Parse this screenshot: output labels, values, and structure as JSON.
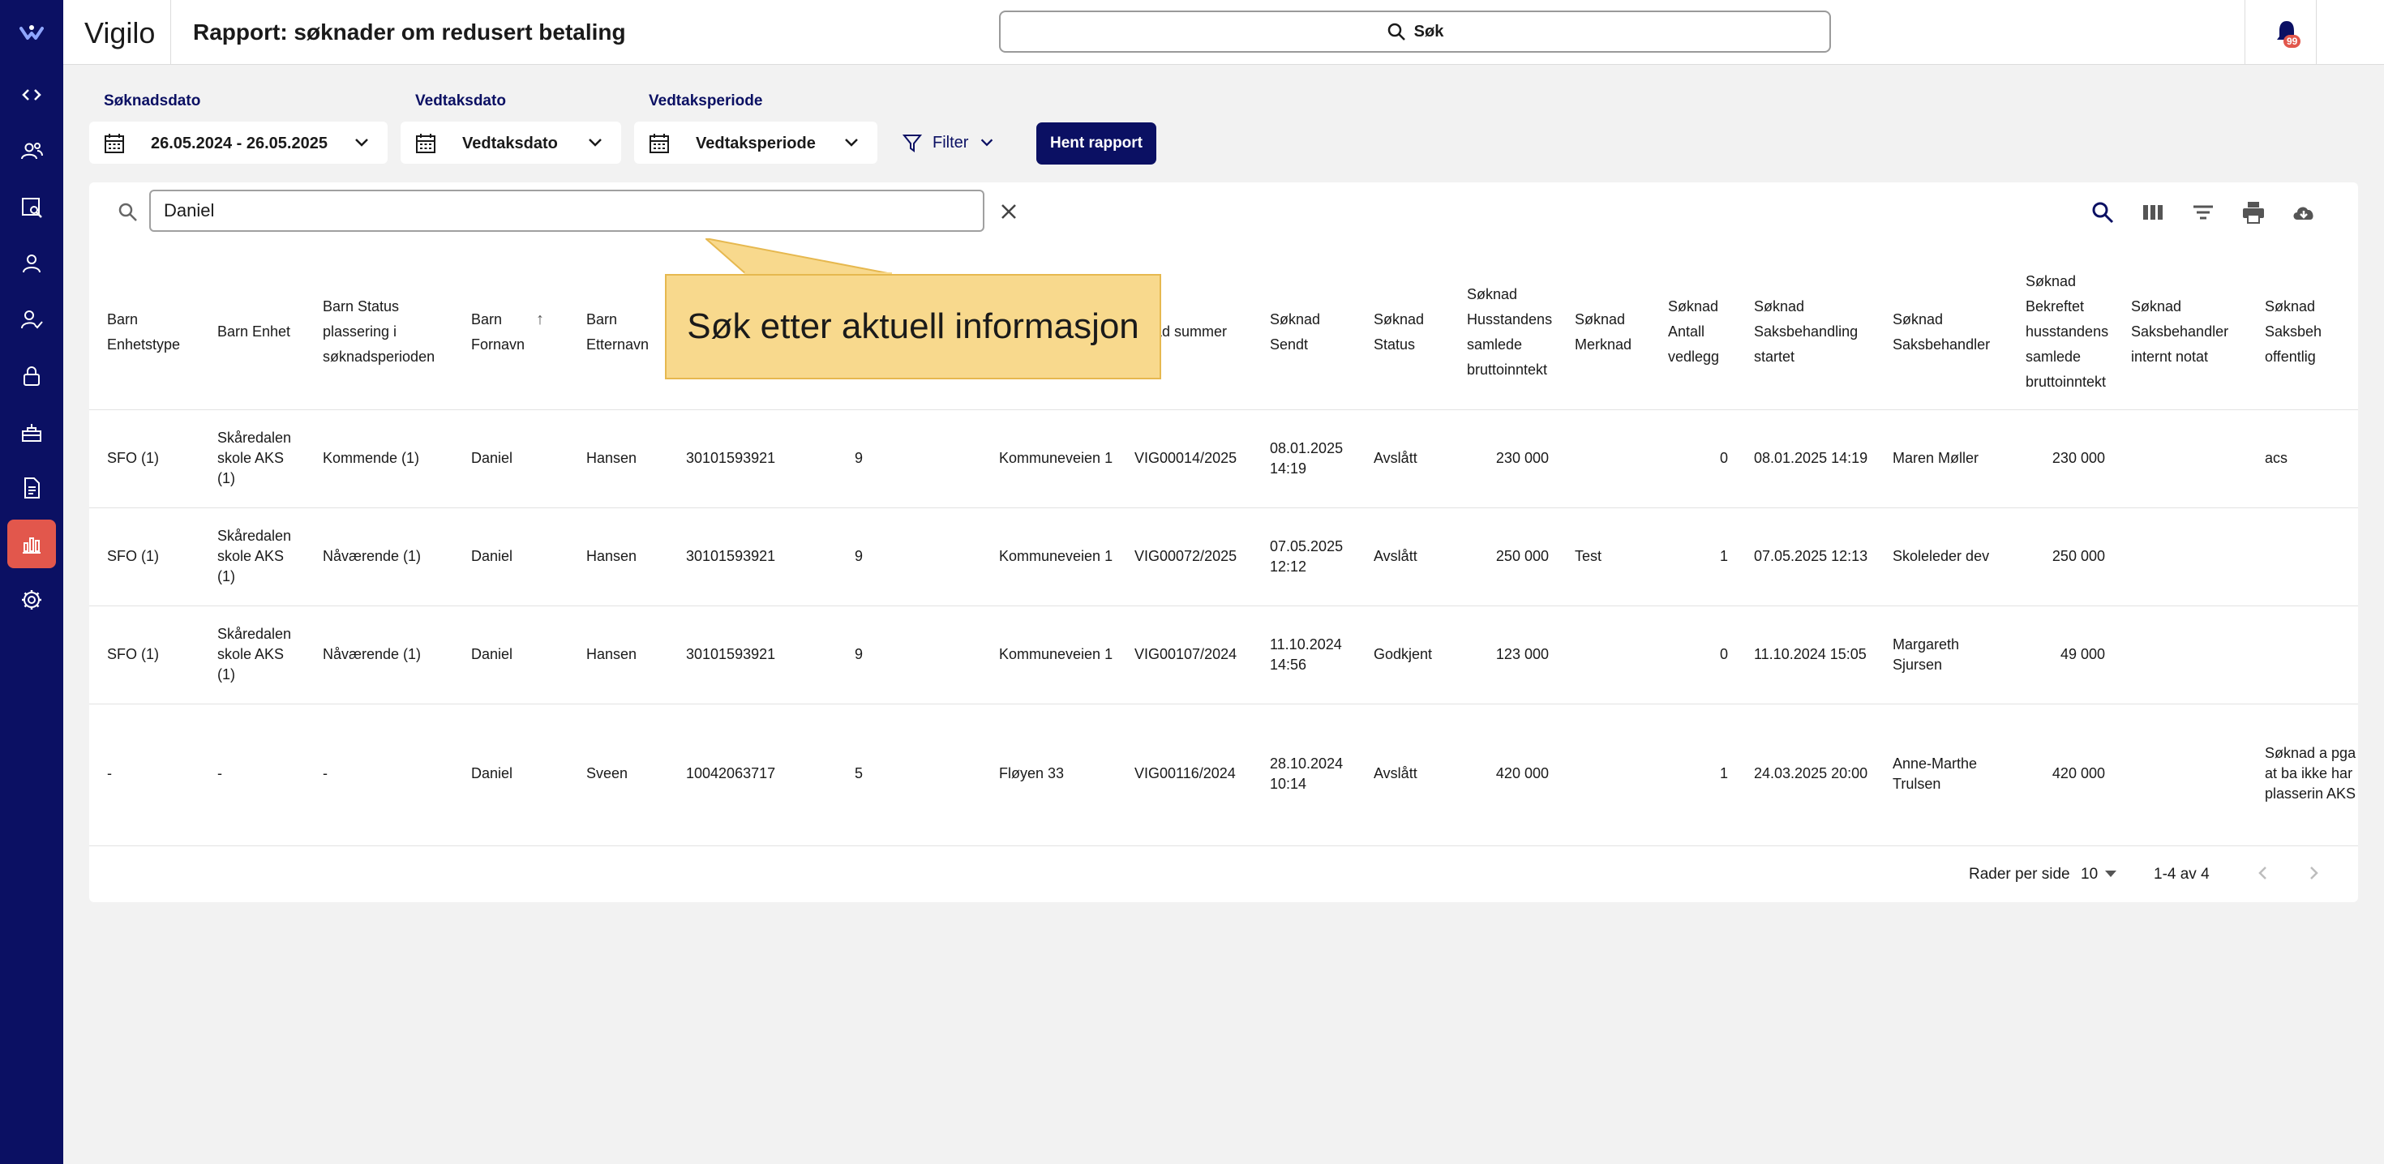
{
  "app": {
    "brand": "Vigilo",
    "page_title": "Rapport: søknader om redusert betaling",
    "global_search_label": "Søk",
    "notification_count": "99"
  },
  "sidebar": {
    "icons": [
      "vigilo-logo-icon",
      "code-icon",
      "group-icon",
      "image-search-icon",
      "person-icon",
      "person-check-icon",
      "lock-icon",
      "lunchbox-icon",
      "document-icon",
      "report-chart-icon",
      "gear-icon"
    ],
    "active": "report-chart-icon",
    "active_color": "#e2574c",
    "bg_color": "#0b1063"
  },
  "filters": {
    "soknadsdato_label": "Søknadsdato",
    "soknadsdato_value": "26.05.2024 - 26.05.2025",
    "vedtaksdato_label": "Vedtaksdato",
    "vedtaksdato_value": "Vedtaksdato",
    "vedtaksperiode_label": "Vedtaksperiode",
    "vedtaksperiode_value": "Vedtaksperiode",
    "filter_label": "Filter",
    "hent_label": "Hent rapport"
  },
  "table_search": {
    "value": "Daniel"
  },
  "tooltip": {
    "text": "Søk etter aktuell informasjon",
    "color": "#f8d98d"
  },
  "table": {
    "headers": {
      "h0": "Barn Enhetstype",
      "h1": "Barn Enhet",
      "h2": "Barn Status plassering i søknadsperioden",
      "h3": "Barn Fornavn",
      "h4": "Barn Etternavn",
      "h5": "",
      "h6": "",
      "h7": "",
      "h8": "nad summer",
      "h9": "Søknad Sendt",
      "h10": "Søknad Status",
      "h11": "Søknad Husstandens samlede bruttoinntekt",
      "h12": "Søknad Merknad",
      "h13": "Søknad Antall vedlegg",
      "h14": "Søknad Saksbehandling startet",
      "h15": "Søknad Saksbehandler",
      "h16": "Søknad Bekreftet husstandens samlede bruttoinntekt",
      "h17": "Søknad Saksbehandler internt notat",
      "h18": "Søknad Saksbeh offentlig"
    },
    "rows": [
      {
        "c0": "SFO (1)",
        "c1": "Skåredalen skole AKS (1)",
        "c2": "Kommende (1)",
        "c3": "Daniel",
        "c4": "Hansen",
        "c5": "30101593921",
        "c6": "9",
        "c7": "Kommuneveien 1",
        "c8": "VIG00014/2025",
        "c9": "08.01.2025 14:19",
        "c10": "Avslått",
        "c11": "230 000",
        "c12": "",
        "c13": "0",
        "c14": "08.01.2025 14:19",
        "c15": "Maren Møller",
        "c16": "230 000",
        "c17": "",
        "c18": "acs"
      },
      {
        "c0": "SFO (1)",
        "c1": "Skåredalen skole AKS (1)",
        "c2": "Nåværende (1)",
        "c3": "Daniel",
        "c4": "Hansen",
        "c5": "30101593921",
        "c6": "9",
        "c7": "Kommuneveien 1",
        "c8": "VIG00072/2025",
        "c9": "07.05.2025 12:12",
        "c10": "Avslått",
        "c11": "250 000",
        "c12": "Test",
        "c13": "1",
        "c14": "07.05.2025 12:13",
        "c15": "Skoleleder dev",
        "c16": "250 000",
        "c17": "",
        "c18": ""
      },
      {
        "c0": "SFO (1)",
        "c1": "Skåredalen skole AKS (1)",
        "c2": "Nåværende (1)",
        "c3": "Daniel",
        "c4": "Hansen",
        "c5": "30101593921",
        "c6": "9",
        "c7": "Kommuneveien 1",
        "c8": "VIG00107/2024",
        "c9": "11.10.2024 14:56",
        "c10": "Godkjent",
        "c11": "123 000",
        "c12": "",
        "c13": "0",
        "c14": "11.10.2024 15:05",
        "c15": "Margareth Sjursen",
        "c16": "49 000",
        "c17": "",
        "c18": ""
      },
      {
        "c0": "-",
        "c1": "-",
        "c2": "-",
        "c3": "Daniel",
        "c4": "Sveen",
        "c5": "10042063717",
        "c6": "5",
        "c7": "Fløyen 33",
        "c8": "VIG00116/2024",
        "c9": "28.10.2024 10:14",
        "c10": "Avslått",
        "c11": "420 000",
        "c12": "",
        "c13": "1",
        "c14": "24.03.2025 20:00",
        "c15": "Anne-Marthe Trulsen",
        "c16": "420 000",
        "c17": "",
        "c18": "Søknad a pga at ba ikke har plasserin AKS"
      }
    ]
  },
  "pagination": {
    "rows_per_page_label": "Rader per side",
    "rows_per_page_value": "10",
    "range": "1-4 av 4"
  }
}
